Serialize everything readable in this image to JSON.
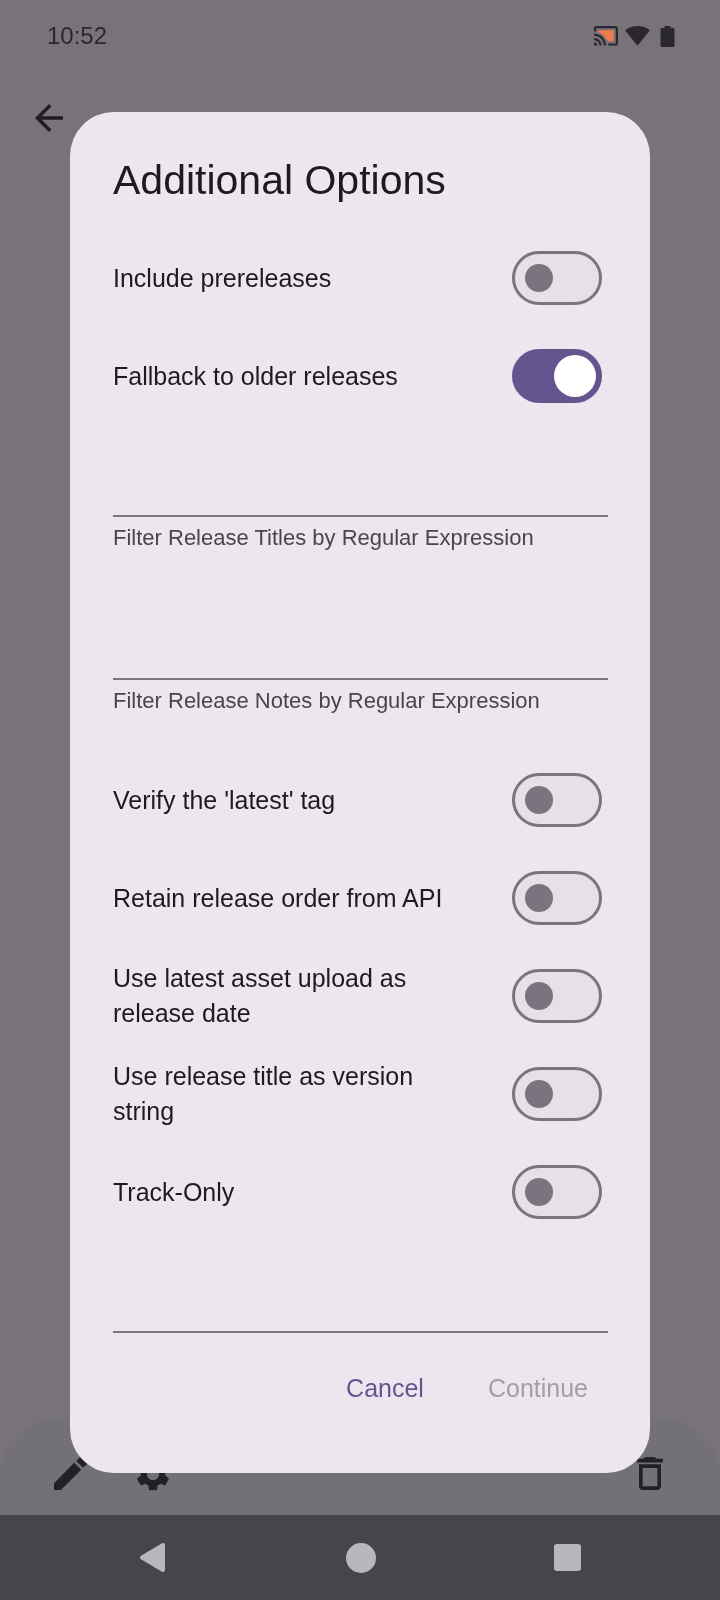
{
  "status_bar": {
    "time": "10:52"
  },
  "dialog": {
    "title": "Additional Options",
    "items": [
      {
        "kind": "switch",
        "label": "Include prereleases",
        "on": false
      },
      {
        "kind": "switch",
        "label": "Fallback to older releases",
        "on": true
      },
      {
        "kind": "text_field",
        "label": "Filter Release Titles by Regular Expression"
      },
      {
        "kind": "text_field",
        "label": "Filter Release Notes by Regular Expression"
      },
      {
        "kind": "switch",
        "label": "Verify the 'latest' tag",
        "on": false
      },
      {
        "kind": "switch",
        "label": "Retain release order from API",
        "on": false
      },
      {
        "kind": "switch",
        "label": "Use latest asset upload as release date",
        "on": false
      },
      {
        "kind": "switch",
        "label": "Use release title as version string",
        "on": false
      },
      {
        "kind": "switch",
        "label": "Track-Only",
        "on": false
      },
      {
        "kind": "text_field"
      }
    ],
    "buttons": [
      {
        "label": "Cancel",
        "disabled": false
      },
      {
        "label": "Continue",
        "disabled": true
      }
    ]
  }
}
